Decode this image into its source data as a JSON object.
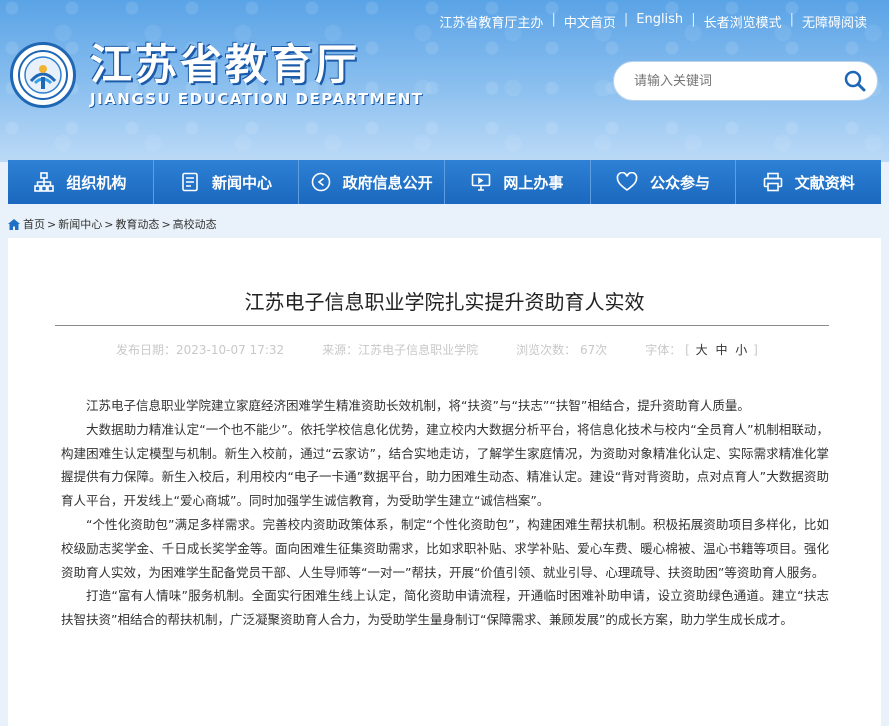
{
  "header": {
    "top_links": [
      "江苏省教育厅主办",
      "中文首页",
      "English",
      "长者浏览模式",
      "无障碍阅读"
    ],
    "title_cn": "江苏省教育厅",
    "title_en": "JIANGSU EDUCATION DEPARTMENT",
    "search_placeholder": "请输入关键词"
  },
  "nav": {
    "items": [
      {
        "label": "组织机构",
        "icon": "org-chart-icon"
      },
      {
        "label": "新闻中心",
        "icon": "document-icon"
      },
      {
        "label": "政府信息公开",
        "icon": "play-circle-icon"
      },
      {
        "label": "网上办事",
        "icon": "monitor-icon"
      },
      {
        "label": "公众参与",
        "icon": "heart-icon"
      },
      {
        "label": "文献资料",
        "icon": "printer-icon"
      }
    ]
  },
  "breadcrumb": [
    "首页",
    "新闻中心",
    "教育动态",
    "高校动态"
  ],
  "article": {
    "title": "江苏电子信息职业学院扎实提升资助育人实效",
    "date_label": "发布日期：2023-10-07 17:32",
    "source_label": "来源：江苏电子信息职业学院",
    "views_label": "浏览次数：  67次",
    "font_label": "字体：",
    "font_open": "[",
    "font_large": "大",
    "font_medium": "中",
    "font_small": "小",
    "font_close": "]",
    "paragraphs": [
      "江苏电子信息职业学院建立家庭经济困难学生精准资助长效机制，将“扶资”与“扶志”“扶智”相结合，提升资助育人质量。",
      "大数据助力精准认定“一个也不能少”。依托学校信息化优势，建立校内大数据分析平台，将信息化技术与校内“全员育人”机制相联动，构建困难生认定模型与机制。新生入校前，通过“云家访”，结合实地走访，了解学生家庭情况，为资助对象精准化认定、实际需求精准化掌握提供有力保障。新生入校后，利用校内“电子一卡通”数据平台，助力困难生动态、精准认定。建设“背对背资助，点对点育人”大数据资助育人平台，开发线上“爱心商城”。同时加强学生诚信教育，为受助学生建立“诚信档案”。",
      "“个性化资助包”满足多样需求。完善校内资助政策体系，制定“个性化资助包”，构建困难生帮扶机制。积极拓展资助项目多样化，比如校级励志奖学金、千日成长奖学金等。面向困难生征集资助需求，比如求职补贴、求学补贴、爱心车费、暖心棉被、温心书籍等项目。强化资助育人实效，为困难学生配备党员干部、人生导师等“一对一”帮扶，开展“价值引领、就业引导、心理疏导、扶资助困”等资助育人服务。",
      "打造“富有人情味”服务机制。全面实行困难生线上认定，简化资助申请流程，开通临时困难补助申请，设立资助绿色通道。建立“扶志扶智扶资”相结合的帮扶机制，广泛凝聚资助育人合力，为受助学生量身制订“保障需求、兼顾发展”的成长方案，助力学生成长成才。"
    ]
  },
  "colors": {
    "nav_bg": "#1f6fc5",
    "header_bg": "#7db6ec",
    "brand_shadow": "#1b5aa8"
  }
}
